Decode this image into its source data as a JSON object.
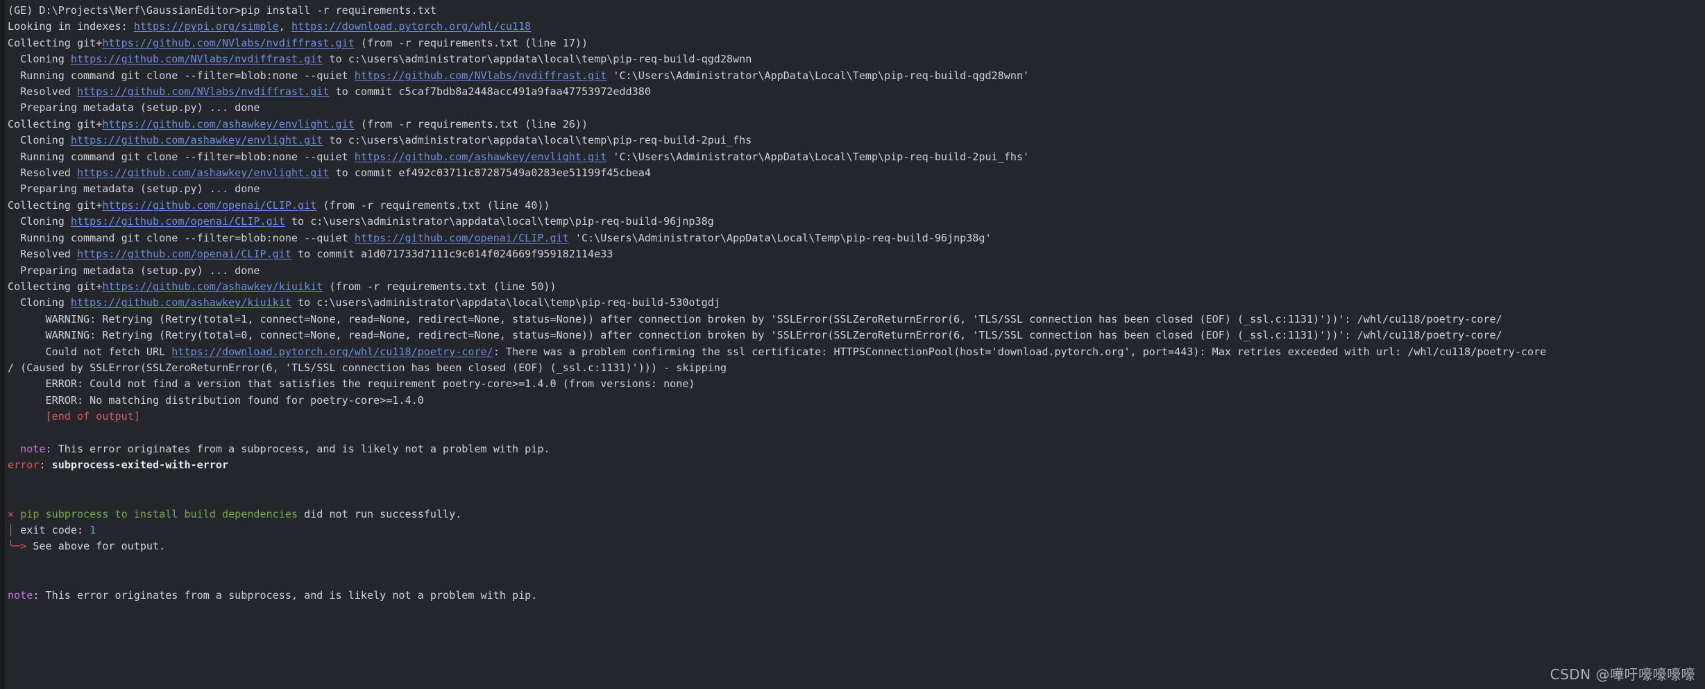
{
  "terminal": {
    "background_color": "#24262b",
    "gutter_color": "#191b1f",
    "foreground_color": "#cfd2d6",
    "link_color": "#6c8fe0",
    "error_color": "#e05561",
    "success_color": "#74a94b",
    "note_color": "#c678dd",
    "number_color": "#2fb3c8"
  },
  "prompt": {
    "env": "(GE)",
    "path": "D:\\Projects\\Nerf\\GaussianEditor>",
    "command": "pip install -r requirements.txt"
  },
  "lines": [
    {
      "id": "prompt-line",
      "segments": [
        {
          "text": "(GE) D:\\Projects\\Nerf\\GaussianEditor>pip install -r requirements.txt",
          "style": "plain"
        }
      ]
    },
    {
      "id": "looking-in-indexes",
      "segments": [
        {
          "text": "Looking in indexes: ",
          "style": "plain"
        },
        {
          "text": "https://pypi.org/simple",
          "style": "link"
        },
        {
          "text": ", ",
          "style": "plain"
        },
        {
          "text": "https://download.pytorch.org/whl/cu118",
          "style": "link"
        }
      ]
    },
    {
      "id": "collecting-nvdiffrast",
      "segments": [
        {
          "text": "Collecting git+",
          "style": "plain"
        },
        {
          "text": "https://github.com/NVlabs/nvdiffrast.git",
          "style": "link"
        },
        {
          "text": " (from -r requirements.txt (line 17))",
          "style": "plain"
        }
      ]
    },
    {
      "id": "cloning-nvdiffrast",
      "segments": [
        {
          "text": "  Cloning ",
          "style": "plain"
        },
        {
          "text": "https://github.com/NVlabs/nvdiffrast.git",
          "style": "link"
        },
        {
          "text": " to c:\\users\\administrator\\appdata\\local\\temp\\pip-req-build-qgd28wnn",
          "style": "plain"
        }
      ]
    },
    {
      "id": "running-clone-nvdiffrast",
      "segments": [
        {
          "text": "  Running command git clone --filter=blob:none --quiet ",
          "style": "plain"
        },
        {
          "text": "https://github.com/NVlabs/nvdiffrast.git",
          "style": "link"
        },
        {
          "text": " 'C:\\Users\\Administrator\\AppData\\Local\\Temp\\pip-req-build-qgd28wnn'",
          "style": "plain"
        }
      ]
    },
    {
      "id": "resolved-nvdiffrast",
      "segments": [
        {
          "text": "  Resolved ",
          "style": "plain"
        },
        {
          "text": "https://github.com/NVlabs/nvdiffrast.git",
          "style": "link"
        },
        {
          "text": " to commit c5caf7bdb8a2448acc491a9faa47753972edd380",
          "style": "plain"
        }
      ]
    },
    {
      "id": "preparing-metadata-nvdiffrast",
      "segments": [
        {
          "text": "  Preparing metadata (setup.py) ... done",
          "style": "plain"
        }
      ]
    },
    {
      "id": "collecting-envlight",
      "segments": [
        {
          "text": "Collecting git+",
          "style": "plain"
        },
        {
          "text": "https://github.com/ashawkey/envlight.git",
          "style": "link"
        },
        {
          "text": " (from -r requirements.txt (line 26))",
          "style": "plain"
        }
      ]
    },
    {
      "id": "cloning-envlight",
      "segments": [
        {
          "text": "  Cloning ",
          "style": "plain"
        },
        {
          "text": "https://github.com/ashawkey/envlight.git",
          "style": "link"
        },
        {
          "text": " to c:\\users\\administrator\\appdata\\local\\temp\\pip-req-build-2pui_fhs",
          "style": "plain"
        }
      ]
    },
    {
      "id": "running-clone-envlight",
      "segments": [
        {
          "text": "  Running command git clone --filter=blob:none --quiet ",
          "style": "plain"
        },
        {
          "text": "https://github.com/ashawkey/envlight.git",
          "style": "link"
        },
        {
          "text": " 'C:\\Users\\Administrator\\AppData\\Local\\Temp\\pip-req-build-2pui_fhs'",
          "style": "plain"
        }
      ]
    },
    {
      "id": "resolved-envlight",
      "segments": [
        {
          "text": "  Resolved ",
          "style": "plain"
        },
        {
          "text": "https://github.com/ashawkey/envlight.git",
          "style": "link"
        },
        {
          "text": " to commit ef492c03711c87287549a0283ee51199f45cbea4",
          "style": "plain"
        }
      ]
    },
    {
      "id": "preparing-metadata-envlight",
      "segments": [
        {
          "text": "  Preparing metadata (setup.py) ... done",
          "style": "plain"
        }
      ]
    },
    {
      "id": "collecting-clip",
      "segments": [
        {
          "text": "Collecting git+",
          "style": "plain"
        },
        {
          "text": "https://github.com/openai/CLIP.git",
          "style": "link"
        },
        {
          "text": " (from -r requirements.txt (line 40))",
          "style": "plain"
        }
      ]
    },
    {
      "id": "cloning-clip",
      "segments": [
        {
          "text": "  Cloning ",
          "style": "plain"
        },
        {
          "text": "https://github.com/openai/CLIP.git",
          "style": "link"
        },
        {
          "text": " to c:\\users\\administrator\\appdata\\local\\temp\\pip-req-build-96jnp38g",
          "style": "plain"
        }
      ]
    },
    {
      "id": "running-clone-clip",
      "segments": [
        {
          "text": "  Running command git clone --filter=blob:none --quiet ",
          "style": "plain"
        },
        {
          "text": "https://github.com/openai/CLIP.git",
          "style": "link"
        },
        {
          "text": " 'C:\\Users\\Administrator\\AppData\\Local\\Temp\\pip-req-build-96jnp38g'",
          "style": "plain"
        }
      ]
    },
    {
      "id": "resolved-clip",
      "segments": [
        {
          "text": "  Resolved ",
          "style": "plain"
        },
        {
          "text": "https://github.com/openai/CLIP.git",
          "style": "link"
        },
        {
          "text": " to commit a1d071733d7111c9c014f024669f959182114e33",
          "style": "plain"
        }
      ]
    },
    {
      "id": "preparing-metadata-clip",
      "segments": [
        {
          "text": "  Preparing metadata (setup.py) ... done",
          "style": "plain"
        }
      ]
    },
    {
      "id": "collecting-kiuikit",
      "segments": [
        {
          "text": "Collecting git+",
          "style": "plain"
        },
        {
          "text": "https://github.com/ashawkey/kiuikit",
          "style": "link"
        },
        {
          "text": " (from -r requirements.txt (line 50))",
          "style": "plain"
        }
      ]
    },
    {
      "id": "cloning-kiuikit",
      "segments": [
        {
          "text": "  Cloning ",
          "style": "plain"
        },
        {
          "text": "https://github.com/ashawkey/kiuikit",
          "style": "link"
        },
        {
          "text": " to c:\\users\\administrator\\appdata\\local\\temp\\pip-req-build-530otgdj",
          "style": "plain"
        }
      ]
    },
    {
      "id": "warning-retry-1",
      "segments": [
        {
          "text": "      WARNING: Retrying (Retry(total=1, connect=None, read=None, redirect=None, status=None)) after connection broken by 'SSLError(SSLZeroReturnError(6, 'TLS/SSL connection has been closed (EOF) (_ssl.c:1131)'))': /whl/cu118/poetry-core/",
          "style": "plain"
        }
      ]
    },
    {
      "id": "warning-retry-0",
      "segments": [
        {
          "text": "      WARNING: Retrying (Retry(total=0, connect=None, read=None, redirect=None, status=None)) after connection broken by 'SSLError(SSLZeroReturnError(6, 'TLS/SSL connection has been closed (EOF) (_ssl.c:1131)'))': /whl/cu118/poetry-core/",
          "style": "plain"
        }
      ]
    },
    {
      "id": "could-not-fetch-url",
      "segments": [
        {
          "text": "      Could not fetch URL ",
          "style": "plain"
        },
        {
          "text": "https://download.pytorch.org/whl/cu118/poetry-core/",
          "style": "link"
        },
        {
          "text": ": There was a problem confirming the ssl certificate: HTTPSConnectionPool(host='download.pytorch.org', port=443): Max retries exceeded with url: /whl/cu118/poetry-core",
          "style": "plain"
        }
      ]
    },
    {
      "id": "caused-by-sslerror",
      "segments": [
        {
          "text": "/ (Caused by SSLError(SSLZeroReturnError(6, 'TLS/SSL connection has been closed (EOF) (_ssl.c:1131)'))) - skipping",
          "style": "plain"
        }
      ]
    },
    {
      "id": "error-could-not-find-version",
      "segments": [
        {
          "text": "      ERROR: Could not find a version that satisfies the requirement poetry-core>=1.4.0 (from versions: none)",
          "style": "plain"
        }
      ]
    },
    {
      "id": "error-no-matching-distribution",
      "segments": [
        {
          "text": "      ERROR: No matching distribution found for poetry-core>=1.4.0",
          "style": "plain"
        }
      ]
    },
    {
      "id": "end-of-output",
      "segments": [
        {
          "text": "      [end of output]",
          "style": "red"
        }
      ]
    },
    {
      "id": "blank-1",
      "segments": [
        {
          "text": " ",
          "style": "plain"
        }
      ]
    },
    {
      "id": "note-subprocess-1",
      "segments": [
        {
          "text": "  note",
          "style": "magenta"
        },
        {
          "text": ": This error originates from a subprocess, and is likely not a problem with pip.",
          "style": "plain"
        }
      ]
    },
    {
      "id": "error-subprocess-exited",
      "segments": [
        {
          "text": "error",
          "style": "red"
        },
        {
          "text": ": ",
          "style": "plain"
        },
        {
          "text": "subprocess-exited-with-error",
          "style": "white-b"
        }
      ]
    },
    {
      "id": "blank-2",
      "segments": [
        {
          "text": " ",
          "style": "plain"
        }
      ]
    },
    {
      "id": "blank-3",
      "segments": [
        {
          "text": " ",
          "style": "plain"
        }
      ]
    },
    {
      "id": "pip-subprocess-failed",
      "segments": [
        {
          "text": "× ",
          "style": "red"
        },
        {
          "text": "pip subprocess to install build dependencies",
          "style": "green"
        },
        {
          "text": " did not run successfully.",
          "style": "plain"
        }
      ]
    },
    {
      "id": "exit-code",
      "segments": [
        {
          "text": "│ ",
          "style": "red"
        },
        {
          "text": "exit code: ",
          "style": "plain"
        },
        {
          "text": "1",
          "style": "cyan"
        }
      ]
    },
    {
      "id": "see-above-for-output",
      "segments": [
        {
          "text": "╰─> ",
          "style": "red"
        },
        {
          "text": "See above for output.",
          "style": "plain"
        }
      ]
    },
    {
      "id": "blank-4",
      "segments": [
        {
          "text": " ",
          "style": "plain"
        }
      ]
    },
    {
      "id": "blank-5",
      "segments": [
        {
          "text": " ",
          "style": "plain"
        }
      ]
    },
    {
      "id": "note-subprocess-2",
      "segments": [
        {
          "text": "note",
          "style": "magenta"
        },
        {
          "text": ": This error originates from a subprocess, and is likely not a problem with pip.",
          "style": "plain"
        }
      ]
    }
  ],
  "watermark": {
    "text": "CSDN @嘩吁嚎嚎嚎嚎"
  }
}
